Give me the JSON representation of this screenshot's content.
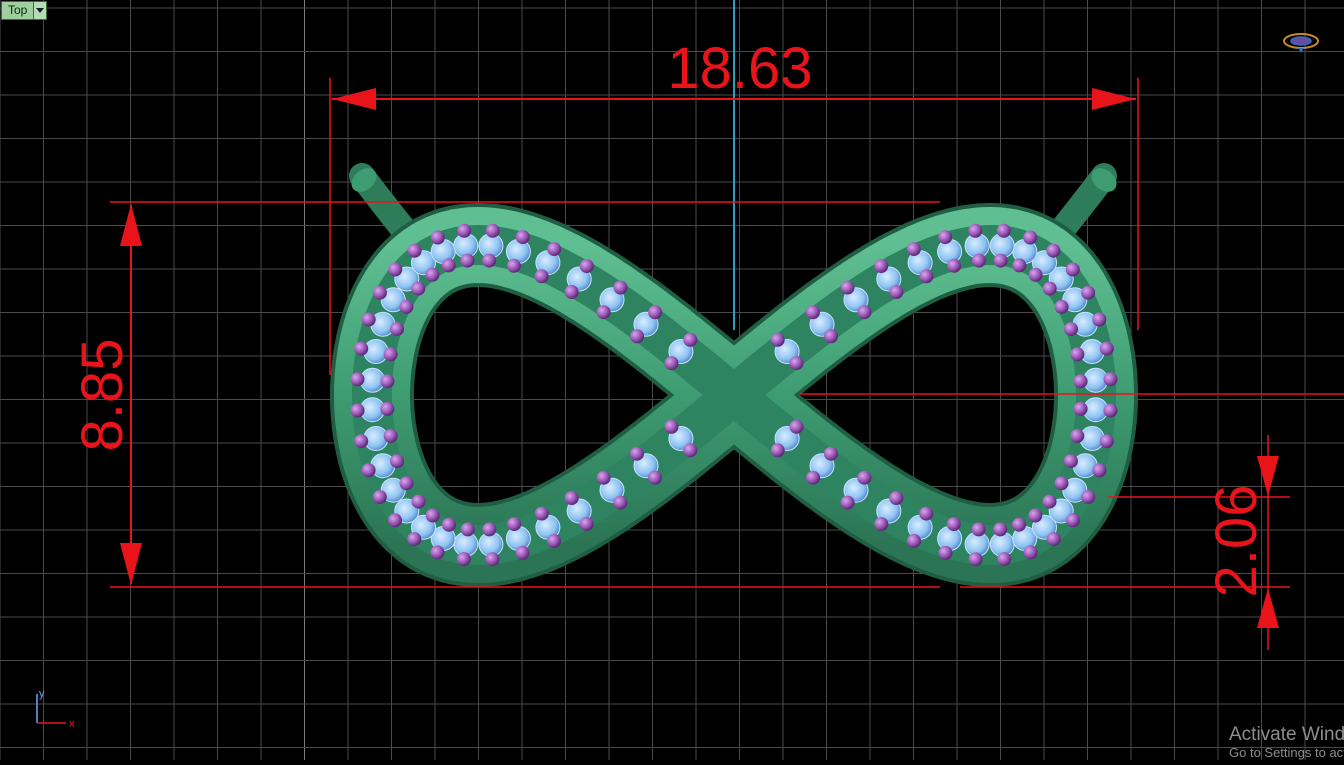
{
  "viewport": {
    "label": "Top",
    "dropdown_icon": "chevron-down-icon",
    "axis_labels": {
      "x": "x",
      "y": "y"
    }
  },
  "dimensions": {
    "width": "18.63",
    "height": "8.85",
    "thickness": "2.06"
  },
  "watermark": {
    "title": "Activate Windows",
    "subtitle": "Go to Settings to activate Windows."
  },
  "colors": {
    "background": "#000000",
    "grid": "#555555",
    "dimension": "#e8141a",
    "axis": "#2aa0c0",
    "metal": "#3e9c72",
    "stone": "#8ec4f2",
    "prong": "#9b59b6"
  },
  "icons": {
    "viewcube": "viewcube-ring-icon",
    "axis_triad": "axis-triad-icon"
  }
}
